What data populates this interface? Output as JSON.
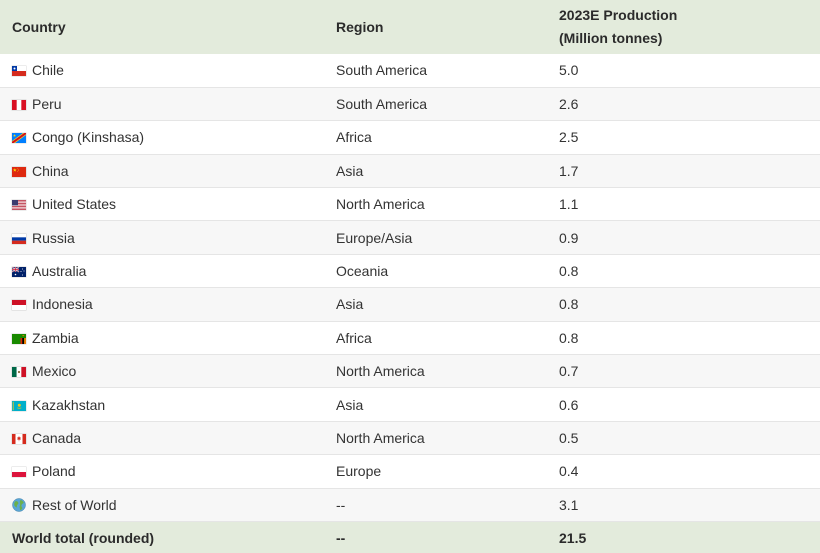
{
  "headers": {
    "country": "Country",
    "region": "Region",
    "production_line1": "2023E Production",
    "production_line2": "(Million tonnes)"
  },
  "rows": [
    {
      "country": "Chile",
      "region": "South America",
      "production": "5.0",
      "flag": "chile-flag-icon"
    },
    {
      "country": "Peru",
      "region": "South America",
      "production": "2.6",
      "flag": "peru-flag-icon"
    },
    {
      "country": "Congo (Kinshasa)",
      "region": "Africa",
      "production": "2.5",
      "flag": "dr-congo-flag-icon"
    },
    {
      "country": "China",
      "region": "Asia",
      "production": "1.7",
      "flag": "china-flag-icon"
    },
    {
      "country": "United States",
      "region": "North America",
      "production": "1.1",
      "flag": "usa-flag-icon"
    },
    {
      "country": "Russia",
      "region": "Europe/Asia",
      "production": "0.9",
      "flag": "russia-flag-icon"
    },
    {
      "country": "Australia",
      "region": "Oceania",
      "production": "0.8",
      "flag": "australia-flag-icon"
    },
    {
      "country": "Indonesia",
      "region": "Asia",
      "production": "0.8",
      "flag": "indonesia-flag-icon"
    },
    {
      "country": "Zambia",
      "region": "Africa",
      "production": "0.8",
      "flag": "zambia-flag-icon"
    },
    {
      "country": "Mexico",
      "region": "North America",
      "production": "0.7",
      "flag": "mexico-flag-icon"
    },
    {
      "country": "Kazakhstan",
      "region": "Asia",
      "production": "0.6",
      "flag": "kazakhstan-flag-icon"
    },
    {
      "country": "Canada",
      "region": "North America",
      "production": "0.5",
      "flag": "canada-flag-icon"
    },
    {
      "country": "Poland",
      "region": "Europe",
      "production": "0.4",
      "flag": "poland-flag-icon"
    },
    {
      "country": "Rest of World",
      "region": "--",
      "production": "3.1",
      "flag": "globe-icon"
    }
  ],
  "total": {
    "country": "World total (rounded)",
    "region": "--",
    "production": "21.5"
  },
  "colors": {
    "header_bg": "#e3ebdc",
    "total_bg": "#e3ebdc",
    "alt_row_bg": "#f7f7f7"
  }
}
